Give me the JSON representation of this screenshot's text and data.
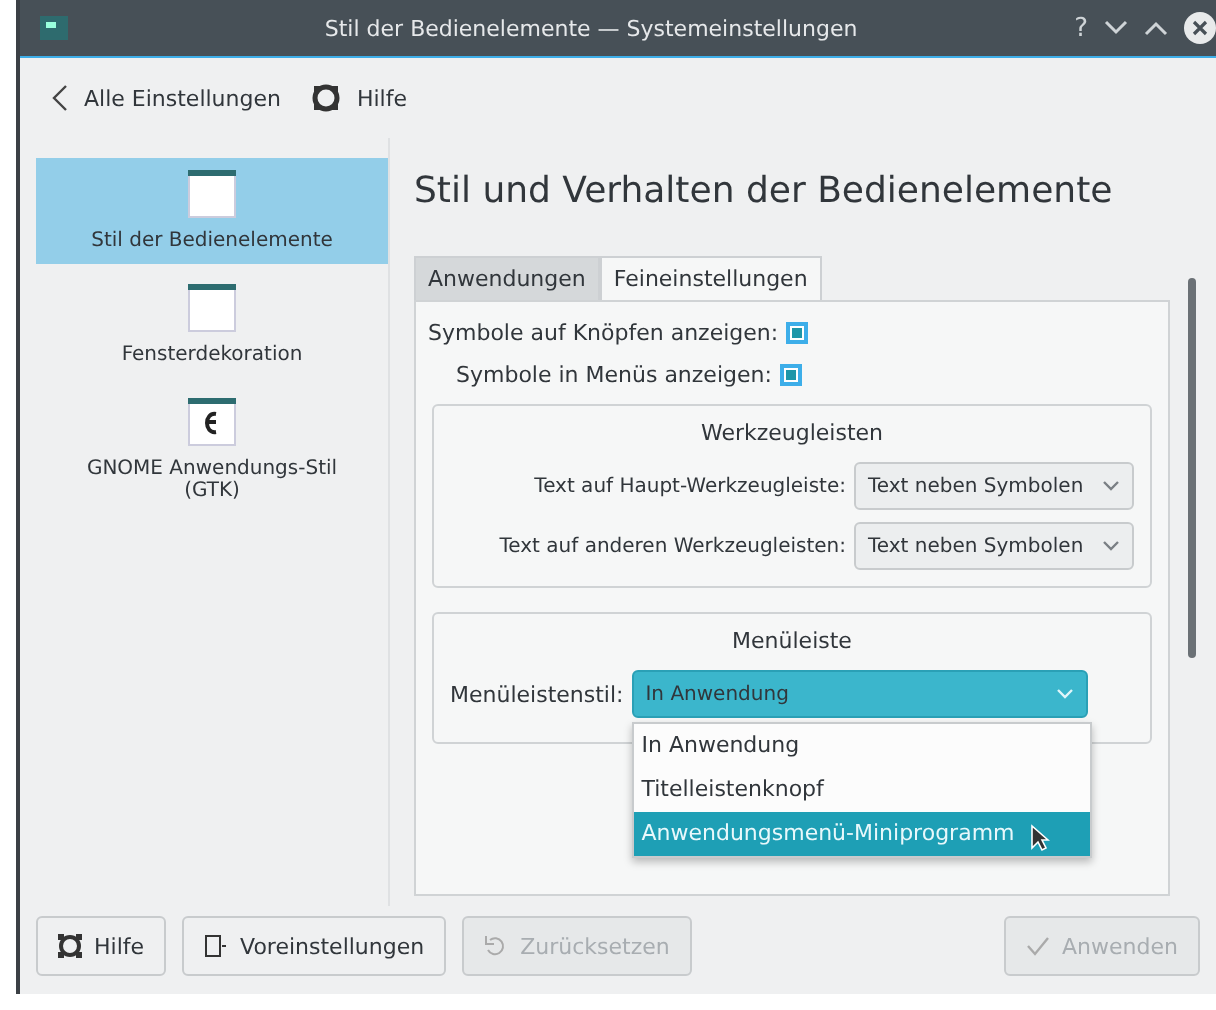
{
  "window": {
    "title": "Stil der Bedienelemente — Systemeinstellungen",
    "help_glyph": "?"
  },
  "toolbar": {
    "back": "Alle Einstellungen",
    "help": "Hilfe"
  },
  "sidebar": {
    "items": [
      {
        "label": "Stil der Bedienelemente",
        "selected": true,
        "kind": "window"
      },
      {
        "label": "Fensterdekoration",
        "selected": false,
        "kind": "window"
      },
      {
        "label": "GNOME Anwendungs-Stil (GTK)",
        "selected": false,
        "kind": "gtk"
      }
    ]
  },
  "heading": "Stil und Verhalten der Bedienelemente",
  "tabs": [
    {
      "label": "Anwendungen",
      "selected": false
    },
    {
      "label": "Feineinstellungen",
      "selected": true
    }
  ],
  "checkboxes": [
    {
      "label": "Symbole auf Knöpfen anzeigen:",
      "checked": true
    },
    {
      "label": "Symbole in Menüs anzeigen:",
      "checked": true
    }
  ],
  "toolbars_group": {
    "title": "Werkzeugleisten",
    "rows": [
      {
        "label": "Text auf Haupt-Werkzeugleiste:",
        "value": "Text neben Symbolen"
      },
      {
        "label": "Text auf anderen Werkzeugleisten:",
        "value": "Text neben Symbolen"
      }
    ]
  },
  "menubar_group": {
    "title": "Menüleiste",
    "label": "Menüleistenstil:",
    "value": "In Anwendung",
    "open": true,
    "options": [
      {
        "label": "In Anwendung",
        "highlighted": false
      },
      {
        "label": "Titelleistenknopf",
        "highlighted": false
      },
      {
        "label": "Anwendungsmenü-Miniprogramm",
        "highlighted": true
      }
    ]
  },
  "buttons": [
    {
      "label": "Hilfe",
      "kind": "help",
      "disabled": false
    },
    {
      "label": "Voreinstellungen",
      "kind": "defaults",
      "disabled": false
    },
    {
      "label": "Zurücksetzen",
      "kind": "reset",
      "disabled": true
    },
    {
      "label": "Anwenden",
      "kind": "apply",
      "disabled": true
    }
  ]
}
